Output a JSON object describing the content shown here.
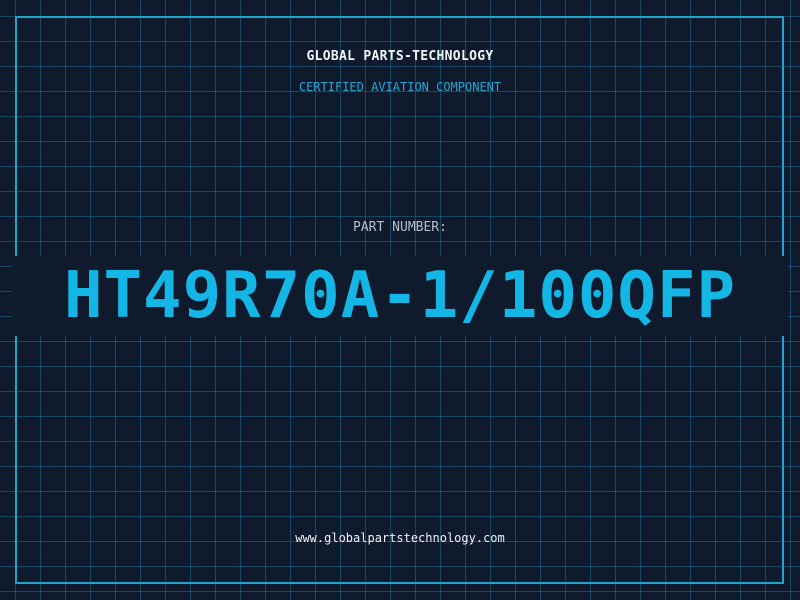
{
  "header": {
    "company": "GLOBAL PARTS-TECHNOLOGY",
    "tagline": "CERTIFIED AVIATION COMPONENT"
  },
  "part": {
    "label": "PART NUMBER:",
    "number": "HT49R70A-1/100QFP"
  },
  "footer": {
    "website": "www.globalpartstechnology.com"
  },
  "colors": {
    "background": "#0f1a2c",
    "grid": "#206e96",
    "accent": "#14b6e6",
    "frame": "#1fa4cc"
  }
}
